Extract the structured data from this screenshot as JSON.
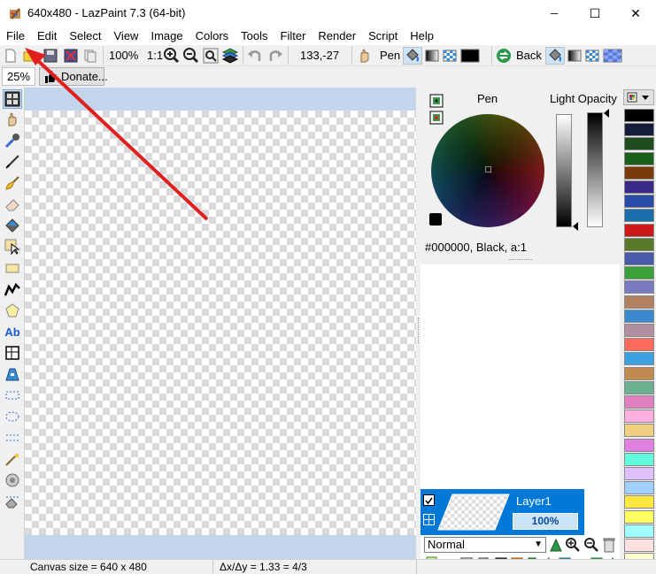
{
  "window": {
    "title": "640x480 - LazPaint 7.3 (64-bit)",
    "minimize_glyph": "─",
    "maximize_glyph": "☐",
    "close_glyph": "✕"
  },
  "menu": [
    "File",
    "Edit",
    "Select",
    "View",
    "Image",
    "Colors",
    "Tools",
    "Filter",
    "Render",
    "Script",
    "Help"
  ],
  "toolbar": {
    "zoom_percent": "100%",
    "zoom_ratio": "1:1",
    "cursor_pos": "133,-27",
    "pen_label": "Pen",
    "back_label": "Back"
  },
  "toolbar2": {
    "zoom_value": "25%",
    "donate_label": "Donate..."
  },
  "color_panel": {
    "pen_label": "Pen",
    "light_opacity_label": "Light Opacity",
    "color_readout": "#000000, Black, a:1"
  },
  "layer": {
    "name": "Layer1",
    "opacity": "100%",
    "blend_mode": "Normal"
  },
  "status": {
    "canvas_size": "Canvas size = 640 x 480",
    "ratio": "Δx/Δy = 1.33 = 4/3"
  },
  "palette_colors": [
    "#000000",
    "#141e3a",
    "#1e4d1e",
    "#1a5f1a",
    "#7a3a0a",
    "#3a2a8a",
    "#2a4aaa",
    "#1a6eaa",
    "#cc1a1a",
    "#5a7a2a",
    "#4a5aaa",
    "#3aa03a",
    "#7a7ac0",
    "#b08060",
    "#3a8ad0",
    "#b090a0",
    "#ff6a5a",
    "#3aa0e0",
    "#c08a50",
    "#6ab090",
    "#e080c0",
    "#ffb0e0",
    "#f0d080",
    "#e080e0",
    "#60ffe0",
    "#e0c0ff",
    "#a0d0ff",
    "#ffe840",
    "#ffff60",
    "#a0ffff",
    "#ffe0e0",
    "#ffffd0"
  ],
  "colors": {
    "accent": "#0078d7",
    "canvas_bg": "#c2d5ea",
    "arrow": "#e02020"
  }
}
